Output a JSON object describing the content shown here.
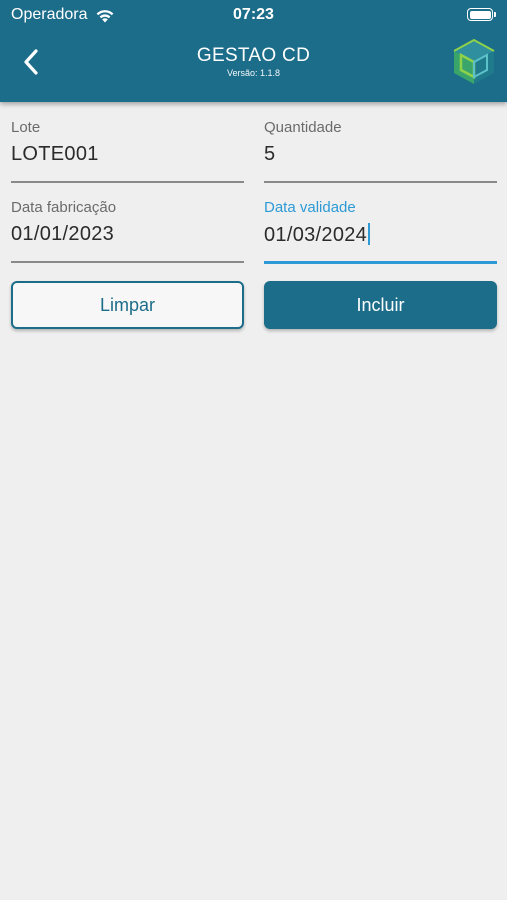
{
  "status_bar": {
    "carrier": "Operadora",
    "time": "07:23"
  },
  "header": {
    "title": "GESTAO CD",
    "version": "Versão:  1.1.8",
    "background_color": "#1c6d8a",
    "back_icon": "chevron-left-icon",
    "logo_icon": "cube-logo-icon"
  },
  "form": {
    "lote": {
      "label": "Lote",
      "value": "LOTE001"
    },
    "quantidade": {
      "label": "Quantidade",
      "value": "5"
    },
    "data_fabricacao": {
      "label": "Data fabricação",
      "value": "01/01/2023"
    },
    "data_validade": {
      "label": "Data validade",
      "value": "01/03/2024",
      "focused": true
    },
    "focus_color": "#2d9ad6"
  },
  "actions": {
    "clear_label": "Limpar",
    "include_label": "Incluir"
  }
}
